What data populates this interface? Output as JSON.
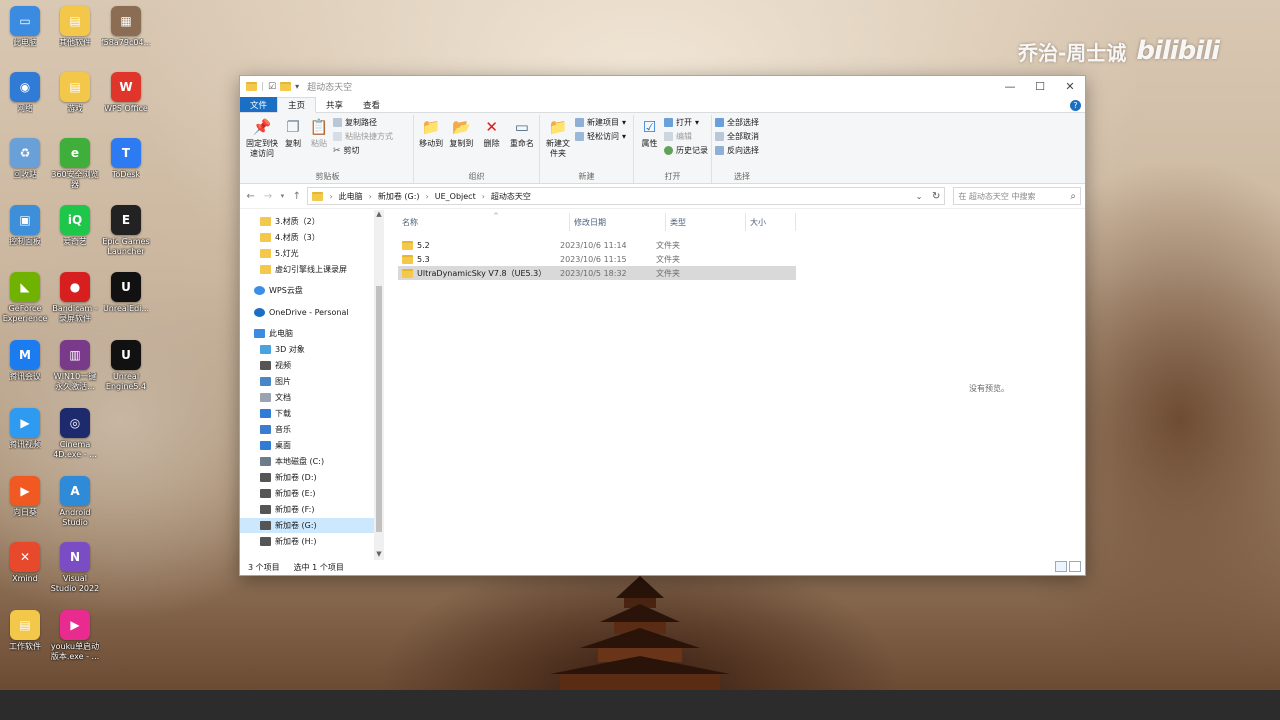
{
  "watermark": {
    "author": "乔治-周士诚",
    "site": "bilibili"
  },
  "desktop_icons": [
    {
      "label": "此电脑",
      "color": "#3b8be0",
      "glyph": "▭",
      "icon": "computer-icon"
    },
    {
      "label": "其他软件",
      "color": "#f3c74a",
      "glyph": "▤",
      "icon": "folder-icon"
    },
    {
      "label": "f58a79c04...",
      "color": "#8a6d52",
      "glyph": "▦",
      "icon": "image-file-icon"
    },
    {
      "label": "网络",
      "color": "#2f7bd6",
      "glyph": "◉",
      "icon": "network-icon"
    },
    {
      "label": "游戏",
      "color": "#f3c74a",
      "glyph": "▤",
      "icon": "folder-icon"
    },
    {
      "label": "WPS Office",
      "color": "#e0352b",
      "glyph": "W",
      "icon": "wps-icon"
    },
    {
      "label": "回收站",
      "color": "#6aa0d8",
      "glyph": "♻",
      "icon": "recycle-bin-icon"
    },
    {
      "label": "360安全浏览器",
      "color": "#3fae3a",
      "glyph": "e",
      "icon": "browser-360-icon"
    },
    {
      "label": "ToDesk",
      "color": "#2c7bf2",
      "glyph": "T",
      "icon": "todesk-icon"
    },
    {
      "label": "控制面板",
      "color": "#3c8fd8",
      "glyph": "▣",
      "icon": "control-panel-icon"
    },
    {
      "label": "爱奇艺",
      "color": "#1ec74a",
      "glyph": "iQ",
      "icon": "iqiyi-icon"
    },
    {
      "label": "Epic Games Launcher",
      "color": "#222222",
      "glyph": "E",
      "icon": "epic-games-icon"
    },
    {
      "label": "GeForce Experience",
      "color": "#6fb300",
      "glyph": "◣",
      "icon": "nvidia-icon"
    },
    {
      "label": "Bandicam - 录屏软件",
      "color": "#d81f1f",
      "glyph": "●",
      "icon": "bandicam-icon"
    },
    {
      "label": "UnrealEdi...",
      "color": "#111111",
      "glyph": "U",
      "icon": "unreal-icon"
    },
    {
      "label": "腾讯会议",
      "color": "#1b7cf0",
      "glyph": "M",
      "icon": "tencent-meeting-icon"
    },
    {
      "label": "WIN10一键永久激活...",
      "color": "#7a3a8a",
      "glyph": "▥",
      "icon": "archive-icon"
    },
    {
      "label": "Unreal Engine5.4",
      "color": "#111111",
      "glyph": "U",
      "icon": "unreal-icon"
    },
    {
      "label": "腾讯视频",
      "color": "#2e9bf0",
      "glyph": "▶",
      "icon": "tencent-video-icon"
    },
    {
      "label": "Cinema 4D.exe - ...",
      "color": "#1d2a6e",
      "glyph": "◎",
      "icon": "cinema4d-icon"
    },
    {
      "label": "向日葵",
      "color": "#f05a22",
      "glyph": "▶",
      "icon": "sunflower-icon"
    },
    {
      "label": "Android Studio",
      "color": "#2f8ad8",
      "glyph": "A",
      "icon": "android-studio-icon"
    },
    {
      "label": "Xmind",
      "color": "#e8482c",
      "glyph": "✕",
      "icon": "xmind-icon"
    },
    {
      "label": "Visual Studio 2022",
      "color": "#7b4dc4",
      "glyph": "N",
      "icon": "visual-studio-icon"
    },
    {
      "label": "工作软件",
      "color": "#f3c74a",
      "glyph": "▤",
      "icon": "folder-icon"
    },
    {
      "label": "youku单启动版本.exe - ...",
      "color": "#e92a8f",
      "glyph": "▶",
      "icon": "youku-icon"
    }
  ],
  "explorer": {
    "title": "超动态天空",
    "tabs": [
      "文件",
      "主页",
      "共享",
      "查看"
    ],
    "ribbon": {
      "clipboard": {
        "name": "剪贴板",
        "pin": "固定到快速访问",
        "copy": "复制",
        "paste": "粘贴",
        "copy_path": "复制路径",
        "paste_shortcut": "粘贴快捷方式",
        "cut": "剪切"
      },
      "organize": {
        "name": "组织",
        "move_to": "移动到",
        "copy_to": "复制到",
        "delete": "删除",
        "rename": "重命名"
      },
      "new": {
        "name": "新建",
        "new_folder": "新建文件夹",
        "new_item": "新建项目",
        "easy_access": "轻松访问"
      },
      "open": {
        "name": "打开",
        "properties": "属性",
        "open": "打开",
        "edit": "编辑",
        "history": "历史记录"
      },
      "select": {
        "name": "选择",
        "select_all": "全部选择",
        "select_none": "全部取消",
        "invert": "反向选择"
      }
    },
    "address": [
      "此电脑",
      "新加卷 (G:)",
      "UE_Object",
      "超动态天空"
    ],
    "search_placeholder": "在 超动态天空 中搜索",
    "nav": [
      {
        "label": "3.材质（2）",
        "icon": "folder-icon",
        "color": "#f4c84a",
        "indent": 20
      },
      {
        "label": "4.材质（3）",
        "icon": "folder-icon",
        "color": "#f4c84a",
        "indent": 20
      },
      {
        "label": "5.灯光",
        "icon": "folder-icon",
        "color": "#f4c84a",
        "indent": 20
      },
      {
        "label": "虚幻引擎线上课录屏",
        "icon": "folder-icon",
        "color": "#f4c84a",
        "indent": 20
      },
      {
        "label": "WPS云盘",
        "icon": "cloud-icon",
        "color": "#3a8ee6",
        "indent": 14
      },
      {
        "label": "OneDrive - Personal",
        "icon": "cloud-icon",
        "color": "#1a6fc4",
        "indent": 14
      },
      {
        "label": "此电脑",
        "icon": "computer-icon",
        "color": "#3b8be0",
        "indent": 14
      },
      {
        "label": "3D 对象",
        "icon": "3d-objects-icon",
        "color": "#4aa3df",
        "indent": 20
      },
      {
        "label": "视频",
        "icon": "video-icon",
        "color": "#555555",
        "indent": 20
      },
      {
        "label": "图片",
        "icon": "pictures-icon",
        "color": "#4a86c6",
        "indent": 20
      },
      {
        "label": "文档",
        "icon": "documents-icon",
        "color": "#9aa4b0",
        "indent": 20
      },
      {
        "label": "下载",
        "icon": "download-icon",
        "color": "#2f7bd6",
        "indent": 20
      },
      {
        "label": "音乐",
        "icon": "music-icon",
        "color": "#3b7bd0",
        "indent": 20
      },
      {
        "label": "桌面",
        "icon": "desktop-icon",
        "color": "#2f7bd6",
        "indent": 20
      },
      {
        "label": "本地磁盘 (C:)",
        "icon": "drive-icon",
        "color": "#6d7b8a",
        "indent": 20
      },
      {
        "label": "新加卷 (D:)",
        "icon": "drive-icon",
        "color": "#555555",
        "indent": 20
      },
      {
        "label": "新加卷 (E:)",
        "icon": "drive-icon",
        "color": "#555555",
        "indent": 20
      },
      {
        "label": "新加卷 (F:)",
        "icon": "drive-icon",
        "color": "#555555",
        "indent": 20
      },
      {
        "label": "新加卷 (G:)",
        "icon": "drive-icon",
        "color": "#555555",
        "indent": 20,
        "selected": true
      },
      {
        "label": "新加卷 (H:)",
        "icon": "drive-icon",
        "color": "#555555",
        "indent": 20
      }
    ],
    "columns": {
      "name": "名称",
      "date": "修改日期",
      "type": "类型",
      "size": "大小"
    },
    "files": [
      {
        "name": "5.2",
        "date": "2023/10/6 11:14",
        "type": "文件夹"
      },
      {
        "name": "5.3",
        "date": "2023/10/6 11:15",
        "type": "文件夹"
      },
      {
        "name": "UltraDynamicSky V7.8（UE5.3）",
        "date": "2023/10/5 18:32",
        "type": "文件夹",
        "selected": true
      }
    ],
    "preview": "没有预览。",
    "status": {
      "count": "3 个项目",
      "selected": "选中 1 个项目"
    }
  }
}
